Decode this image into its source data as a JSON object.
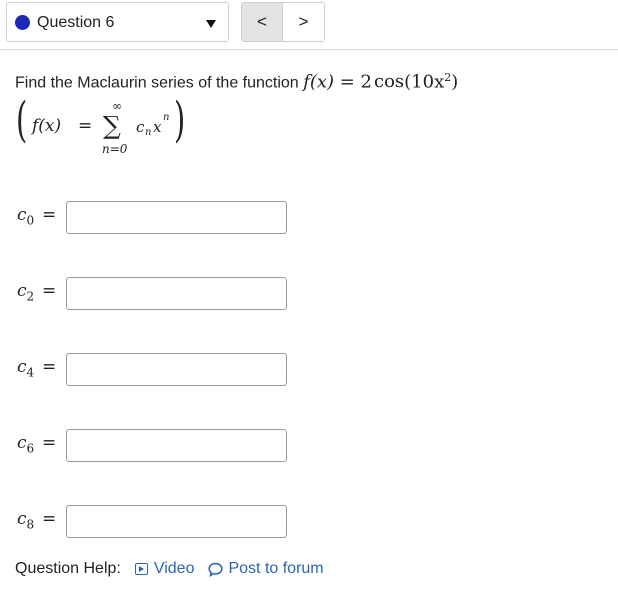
{
  "header": {
    "question_label": "Question 6",
    "prev_label": "<",
    "next_label": ">"
  },
  "colors": {
    "status_dot": "#1c29b8",
    "link": "#2b64b6"
  },
  "prompt": {
    "text": "Find the Maclaurin series of the function ",
    "fx": "f(x)",
    "eq": " = ",
    "rhs_coef": "2",
    "rhs_fn": "cos",
    "rhs_arg": "(10x",
    "rhs_exp": "2",
    "rhs_close": ")"
  },
  "formula": {
    "open_paren": "(",
    "lhs": "f(x)",
    "eq": "=",
    "sigma": "∑",
    "upper": "∞",
    "lower": "n=0",
    "term": "c",
    "term_sub": "n",
    "term_var": "x",
    "term_exp": "n",
    "close_paren": ")"
  },
  "coefficients": [
    {
      "symbol": "c",
      "index": "0",
      "eq": "=",
      "value": ""
    },
    {
      "symbol": "c",
      "index": "2",
      "eq": "=",
      "value": ""
    },
    {
      "symbol": "c",
      "index": "4",
      "eq": "=",
      "value": ""
    },
    {
      "symbol": "c",
      "index": "6",
      "eq": "=",
      "value": ""
    },
    {
      "symbol": "c",
      "index": "8",
      "eq": "=",
      "value": ""
    }
  ],
  "help": {
    "label": "Question Help:",
    "video_label": "Video",
    "video_icon": "video-play-icon",
    "forum_label": "Post to forum",
    "forum_icon": "speech-bubble-icon"
  }
}
